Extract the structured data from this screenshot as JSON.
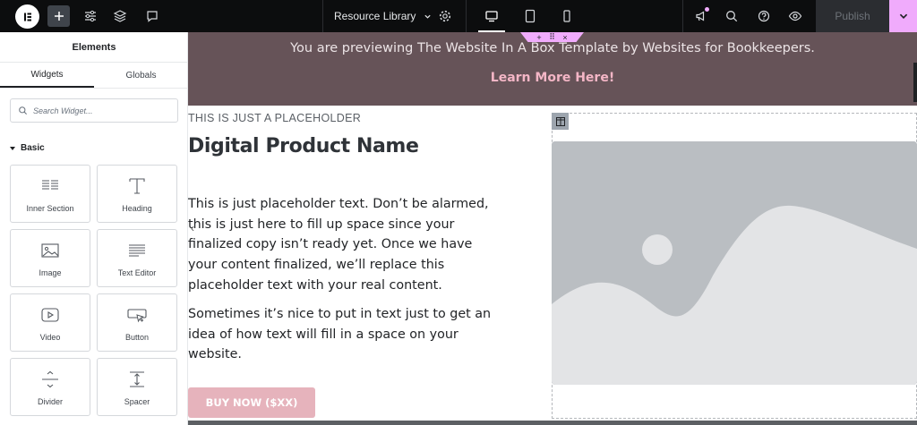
{
  "topbar": {
    "resource_library": "Resource Library",
    "publish": "Publish",
    "icons": [
      "elementor-logo-icon",
      "plus-icon",
      "sliders-icon",
      "layers-icon",
      "comment-icon",
      "settings-icon",
      "desktop-icon",
      "tablet-icon",
      "mobile-icon",
      "announcement-icon",
      "search-icon",
      "help-icon",
      "eye-icon",
      "chevron-down-icon"
    ],
    "accent": "#f0abfc"
  },
  "sidebar": {
    "title": "Elements",
    "tabs": [
      "Widgets",
      "Globals"
    ],
    "search_placeholder": "Search Widget...",
    "category": "Basic",
    "widgets": [
      {
        "label": "Inner Section",
        "icon": "inner-section-icon"
      },
      {
        "label": "Heading",
        "icon": "heading-icon"
      },
      {
        "label": "Image",
        "icon": "image-icon"
      },
      {
        "label": "Text Editor",
        "icon": "text-editor-icon"
      },
      {
        "label": "Video",
        "icon": "video-icon"
      },
      {
        "label": "Button",
        "icon": "button-icon"
      },
      {
        "label": "Divider",
        "icon": "divider-icon"
      },
      {
        "label": "Spacer",
        "icon": "spacer-icon"
      }
    ]
  },
  "canvas": {
    "banner_text": "You are previewing The Website In A Box Template by Websites for Bookkeepers.",
    "banner_link": "Learn More Here!",
    "section_handle": [
      "+",
      "⠿",
      "×"
    ],
    "collapse_arrow": "‹",
    "eyebrow": "THIS IS JUST A PLACEHOLDER",
    "product_name": "Digital Product Name",
    "paragraph_1": "This is just placeholder text. Don’t be alarmed, this is just here to fill up space since your finalized copy isn’t ready yet. Once we have your content finalized, we’ll replace this placeholder text with your real content.",
    "paragraph_2": "Sometimes it’s nice to put in text just to get an idea of how text will fill in a space on your website.",
    "buy_button": "BUY NOW ($XX)",
    "banner_color": "#665358",
    "button_color": "#e6b3bc"
  }
}
